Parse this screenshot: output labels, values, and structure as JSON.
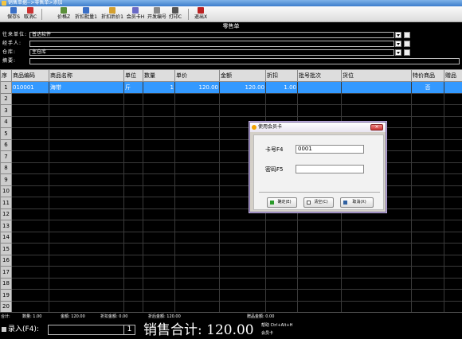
{
  "window_title": "销售单据-->零售单>添加",
  "toolbar": {
    "save_label": "保存S",
    "cancel_label": "取消C",
    "price_label": "价格Z",
    "discount_label": "折扣批量1",
    "discount_after_label": "折扣后价1",
    "member_label": "会员卡H",
    "invoice_label": "开发编号",
    "print_label": "打印C",
    "exit_label": "退出X"
  },
  "form_title": "零售单",
  "fields": {
    "unit_label": "往来单位:",
    "unit_value": "普达软件",
    "handler_label": "经手人:",
    "handler_value": "",
    "warehouse_label": "仓库:",
    "warehouse_value": "主仓库",
    "note_label": "摘要:",
    "note_value": ""
  },
  "table": {
    "headers": [
      "序",
      "商品编码",
      "商品名称",
      "单位",
      "数量",
      "单价",
      "金额",
      "折扣",
      "批号批次",
      "货位",
      "特价商品",
      "赠品"
    ],
    "rows": [
      {
        "n": "1",
        "code": "010001",
        "name": "海带",
        "unit": "斤",
        "qty": "1",
        "price": "120.00",
        "amount": "120.00",
        "discount": "1.00",
        "batch": "",
        "loc": "",
        "special": "否",
        "gift": ""
      }
    ],
    "row_numbers": [
      "1",
      "2",
      "3",
      "4",
      "5",
      "6",
      "7",
      "8",
      "9",
      "10",
      "11",
      "12",
      "13",
      "14",
      "15",
      "16",
      "17",
      "18",
      "19",
      "20"
    ]
  },
  "summary": {
    "total_label": "合计:",
    "qty_label": "数量: 1.00",
    "amount_label": "金额: 120.00",
    "discount_amt_label": "折扣金额: 0.00",
    "after_discount_label": "折后金额: 120.00",
    "gift_amount_label": "赠品金额: 0.00"
  },
  "bottom": {
    "entry_label": "录入(F4):",
    "entry_qty": "1",
    "total_text": "销售合计: 120.00",
    "help_line1": "帮助 Ctrl+Alt+H",
    "help_line2": "会员卡"
  },
  "dialog": {
    "title": "使用会员卡",
    "close_label": "×",
    "card_label": "卡号F4",
    "card_value": "0001",
    "password_label": "密码F5",
    "password_value": "",
    "ok_label": "确定(E)",
    "clear_label": "清空(C)",
    "cancel_label": "取消(X)"
  },
  "colors": {
    "selection": "#3399ff",
    "background": "#000000"
  }
}
